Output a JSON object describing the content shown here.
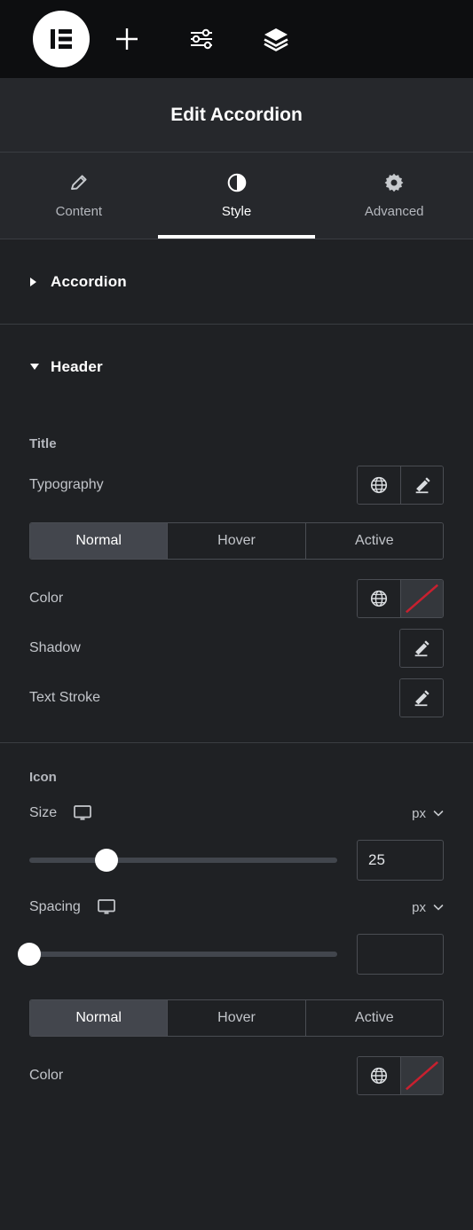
{
  "toolbar": {
    "logo_label": "elementor-logo",
    "buttons": [
      {
        "name": "add-element-button",
        "icon": "plus-icon"
      },
      {
        "name": "settings-button",
        "icon": "sliders-icon"
      },
      {
        "name": "navigator-button",
        "icon": "layers-icon"
      }
    ]
  },
  "header": {
    "title": "Edit Accordion"
  },
  "tabs": [
    {
      "label": "Content",
      "icon": "pencil-icon",
      "active": false
    },
    {
      "label": "Style",
      "icon": "contrast-icon",
      "active": true
    },
    {
      "label": "Advanced",
      "icon": "gear-icon",
      "active": false
    }
  ],
  "sections": {
    "accordion": {
      "title": "Accordion",
      "expanded": false
    },
    "header": {
      "title": "Header",
      "expanded": true
    }
  },
  "title_group": {
    "label": "Title",
    "typography": {
      "label": "Typography",
      "globe_icon": "globe-icon",
      "edit_icon": "pencil-icon"
    },
    "states": [
      {
        "label": "Normal",
        "selected": true
      },
      {
        "label": "Hover",
        "selected": false
      },
      {
        "label": "Active",
        "selected": false
      }
    ],
    "color": {
      "label": "Color",
      "globe_icon": "globe-icon",
      "swatch": "no-color",
      "swatch_slash_color": "#c8202f"
    },
    "shadow": {
      "label": "Shadow",
      "edit_icon": "pencil-icon"
    },
    "text_stroke": {
      "label": "Text Stroke",
      "edit_icon": "pencil-icon"
    }
  },
  "icon_group": {
    "label": "Icon",
    "size": {
      "label": "Size",
      "device_icon": "desktop-icon",
      "unit": "px",
      "value": "25",
      "slider_percent": 25
    },
    "spacing": {
      "label": "Spacing",
      "device_icon": "desktop-icon",
      "unit": "px",
      "value": "",
      "slider_percent": 0
    },
    "states": [
      {
        "label": "Normal",
        "selected": true
      },
      {
        "label": "Hover",
        "selected": false
      },
      {
        "label": "Active",
        "selected": false
      }
    ],
    "color": {
      "label": "Color",
      "globe_icon": "globe-icon",
      "swatch": "no-color",
      "swatch_slash_color": "#c8202f"
    }
  },
  "theme": {
    "panel_bg": "#1f2124",
    "toolbar_bg": "#0d0e10",
    "header_bg": "#26282c",
    "border": "#3a3d42",
    "accent_text": "#ffffff",
    "active_tab_bg": "#43464d"
  }
}
